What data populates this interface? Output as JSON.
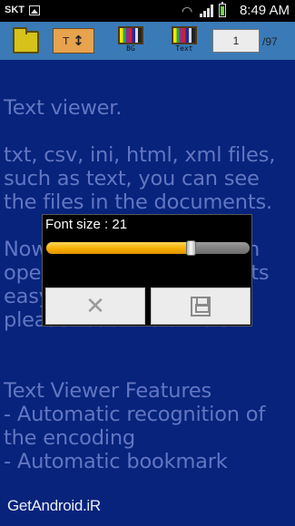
{
  "status_bar": {
    "carrier": "SKT",
    "time": "8:49 AM",
    "icons": [
      "gallery-icon",
      "wifi-icon",
      "signal-icon",
      "battery-icon"
    ]
  },
  "toolbar": {
    "folder_icon": "folder-icon",
    "font_size_button_label": "T",
    "font_size_button_icon": "↕",
    "bg_color_label": "BG",
    "text_color_label": "Text",
    "page_current": "1",
    "page_total": "/97"
  },
  "document": {
    "text": "Text viewer.\n\ntxt, csv, ini, html, xml files,\nsuch as text, you can see\nthe files in the documents.\n\nNow, if you read, you can\nopen and view documents easy,\nplease read the article.\n\n\nText Viewer Features\n- Automatic recognition of\nthe encoding\n- Automatic bookmark"
  },
  "font_size_dialog": {
    "title": "Font size : 21",
    "slider_fraction": 0.71,
    "cancel_icon": "close-icon",
    "save_icon": "save-icon"
  },
  "watermark": "GetAndroid.iR",
  "colors": {
    "toolbar_bg": "#3a7ab6",
    "content_bg": "#07237c",
    "content_text": "#6276c1",
    "slider_fill": "#f5b000"
  }
}
